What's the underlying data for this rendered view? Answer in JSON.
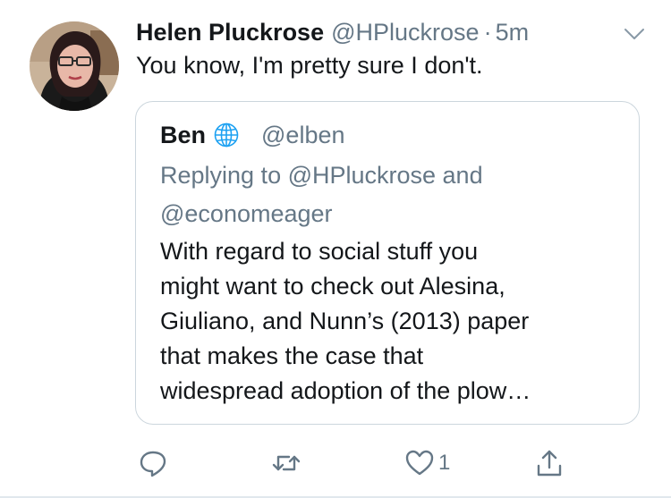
{
  "tweet": {
    "author_name": "Helen Pluckrose",
    "author_handle": "@HPluckrose",
    "separator": "·",
    "time": "5m",
    "text": "You know, I'm pretty sure I don't."
  },
  "quoted_tweet": {
    "author_name": "Ben",
    "author_handle": "@elben",
    "replying_lines": [
      "Replying to @HPluckrose and",
      "@economeager"
    ],
    "text_lines": [
      "With regard to social stuff you",
      "might want to check out Alesina,",
      "Giuliano, and Nunn’s (2013) paper",
      "that makes the case that",
      "widespread adoption of the plow…"
    ]
  },
  "actions": {
    "reply_icon": "reply-icon",
    "retweet_icon": "retweet-icon",
    "like_icon": "heart-icon",
    "like_count": "1",
    "share_icon": "share-icon"
  },
  "colors": {
    "text": "#14171a",
    "secondary": "#657786",
    "border": "#ccd6dd",
    "globe": "#1da1f2"
  }
}
